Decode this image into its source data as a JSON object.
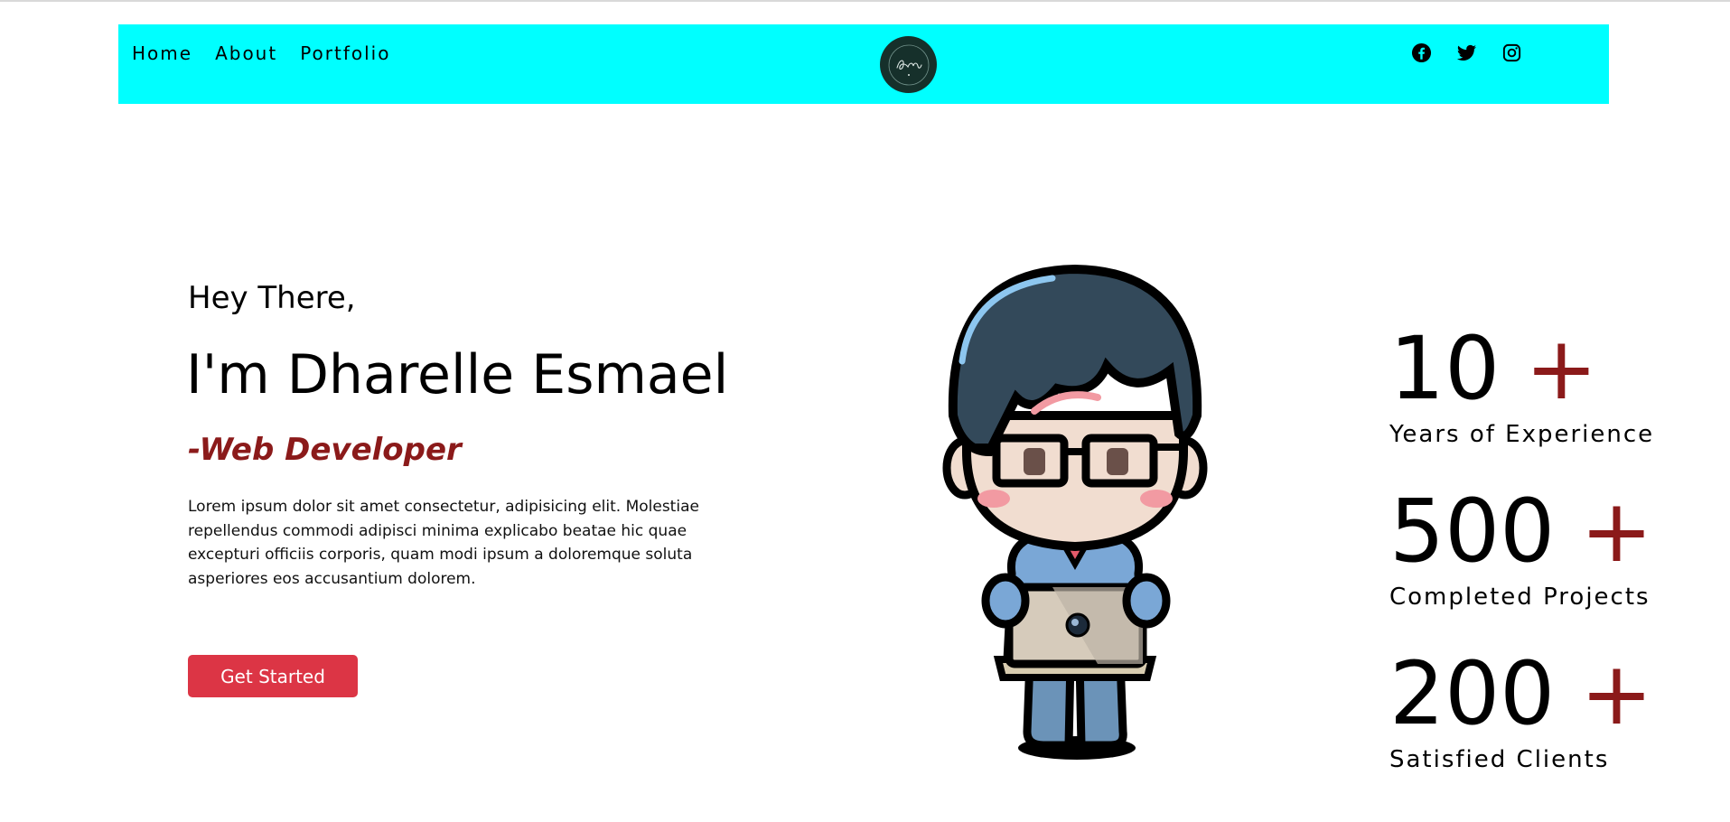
{
  "nav": {
    "links": [
      "Home",
      "About",
      "Portfolio"
    ],
    "logo_text": "Ramzy",
    "social_icons": [
      "facebook-icon",
      "twitter-icon",
      "instagram-icon"
    ],
    "background": "#00ffff"
  },
  "hero": {
    "greeting": "Hey There,",
    "name": "I'm Dharelle Esmael",
    "role": "-Web Developer",
    "description": "Lorem ipsum dolor sit amet consectetur, adipisicing elit. Molestiae repellendus commodi adipisci minima explicabo beatae hic quae excepturi officiis corporis, quam modi ipsum a doloremque soluta asperiores eos accusantium dolorem.",
    "cta_label": "Get Started",
    "cta_color": "#dc3545",
    "accent_color": "#8b1a1a"
  },
  "stats": [
    {
      "number": "10",
      "plus": "+",
      "label": "Years of Experience"
    },
    {
      "number": "500",
      "plus": "+",
      "label": "Completed Projects"
    },
    {
      "number": "200",
      "plus": "+",
      "label": "Satisfied Clients"
    }
  ]
}
